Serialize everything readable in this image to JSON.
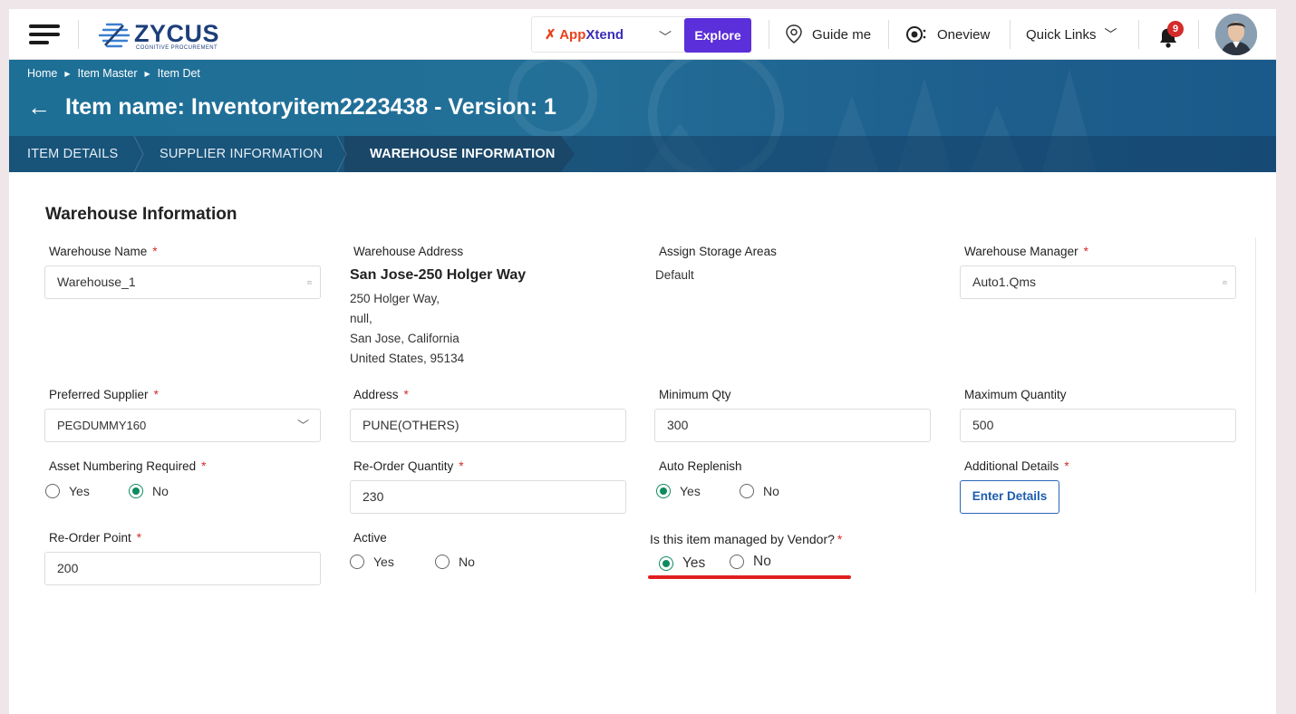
{
  "topbar": {
    "logo_text": "ZYCUS",
    "logo_sub": "COGNITIVE PROCUREMENT",
    "appxtend_prefix": "App",
    "appxtend_suffix": "Xtend",
    "explore_label": "Explore",
    "guide_label": "Guide me",
    "oneview_label": "Oneview",
    "quicklinks_label": "Quick Links",
    "notification_count": "9",
    "colors": {
      "explore": "#5b2fd9",
      "badge": "#d52b2b"
    }
  },
  "breadcrumb": [
    "Home",
    "Item Master",
    "Item Det"
  ],
  "page_title": "Item name: Inventoryitem2223438 - Version: 1",
  "tabs": [
    "ITEM DETAILS",
    "SUPPLIER INFORMATION",
    "WAREHOUSE INFORMATION"
  ],
  "active_tab": "WAREHOUSE INFORMATION",
  "section_title": "Warehouse Information",
  "form": {
    "warehouse_name": {
      "label": "Warehouse Name",
      "value": "Warehouse_1"
    },
    "warehouse_address": {
      "label": "Warehouse Address",
      "name": "San Jose-250 Holger Way",
      "lines": [
        "250 Holger Way,",
        "null,",
        "San Jose, California",
        "United States, 95134"
      ]
    },
    "assign_storage": {
      "label": "Assign Storage Areas",
      "value": "Default"
    },
    "warehouse_manager": {
      "label": "Warehouse Manager",
      "value": "Auto1.Qms"
    },
    "preferred_supplier": {
      "label": "Preferred Supplier",
      "value": "PEGDUMMY160"
    },
    "address": {
      "label": "Address",
      "value": "PUNE(OTHERS)"
    },
    "minimum_qty": {
      "label": "Minimum Qty",
      "value": "300"
    },
    "maximum_quantity": {
      "label": "Maximum Quantity",
      "value": "500"
    },
    "asset_numbering": {
      "label": "Asset Numbering Required",
      "yes": "Yes",
      "no": "No",
      "selected": "No"
    },
    "reorder_quantity": {
      "label": "Re-Order Quantity",
      "value": "230"
    },
    "auto_replenish": {
      "label": "Auto Replenish",
      "yes": "Yes",
      "no": "No",
      "selected": "Yes"
    },
    "additional_details": {
      "label": "Additional Details",
      "button": "Enter Details"
    },
    "reorder_point": {
      "label": "Re-Order Point",
      "value": "200"
    },
    "active": {
      "label": "Active",
      "yes": "Yes",
      "no": "No",
      "selected": ""
    },
    "managed_by_vendor": {
      "label": "Is this item managed by Vendor?",
      "yes": "Yes",
      "no": "No",
      "selected": "Yes"
    }
  },
  "required_mark": "*",
  "colors": {
    "accent_green": "#0e8a5f",
    "required_red": "#d52b2b",
    "highlight_red": "#e11e1e"
  }
}
